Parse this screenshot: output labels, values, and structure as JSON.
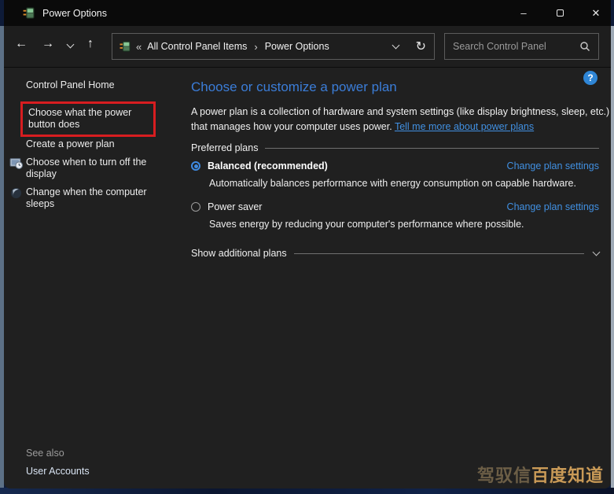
{
  "window": {
    "title": "Power Options"
  },
  "icons": {
    "app": "power-options-battery-plug",
    "back": "←",
    "forward": "→",
    "up": "↑",
    "guillemet": "«",
    "crumb_separator": "›",
    "refresh": "↻",
    "minimize": "–",
    "close": "✕",
    "help": "?"
  },
  "navbar": {
    "breadcrumb": [
      "All Control Panel Items",
      "Power Options"
    ],
    "search_placeholder": "Search Control Panel"
  },
  "sidebar": {
    "home": "Control Panel Home",
    "items": [
      {
        "label": "Choose what the power button does",
        "annotated": true
      },
      {
        "label": "Create a power plan"
      },
      {
        "label": "Choose when to turn off the display",
        "icon": "display-clock-icon"
      },
      {
        "label": "Change when the computer sleeps",
        "icon": "sleep-sphere-icon"
      }
    ],
    "see_also": "See also",
    "links": [
      "User Accounts"
    ]
  },
  "main": {
    "heading": "Choose or customize a power plan",
    "intro_text": "A power plan is a collection of hardware and system settings (like display brightness, sleep, etc.) that manages how your computer uses power. ",
    "intro_link": "Tell me more about power plans",
    "section": "Preferred plans",
    "plans": [
      {
        "name": "Balanced (recommended)",
        "selected": true,
        "description": "Automatically balances performance with energy consumption on capable hardware.",
        "link": "Change plan settings"
      },
      {
        "name": "Power saver",
        "selected": false,
        "description": "Saves energy by reducing your computer's performance where possible.",
        "link": "Change plan settings"
      }
    ],
    "show_additional": "Show additional plans"
  },
  "watermark": {
    "prefix": "驾驭信",
    "brand": "百度知道"
  },
  "colors": {
    "heading_blue": "#3b7dd8",
    "link_blue": "#4190e2",
    "annotation_red": "#d71d20",
    "accent_radio": "#3f8ae0"
  }
}
